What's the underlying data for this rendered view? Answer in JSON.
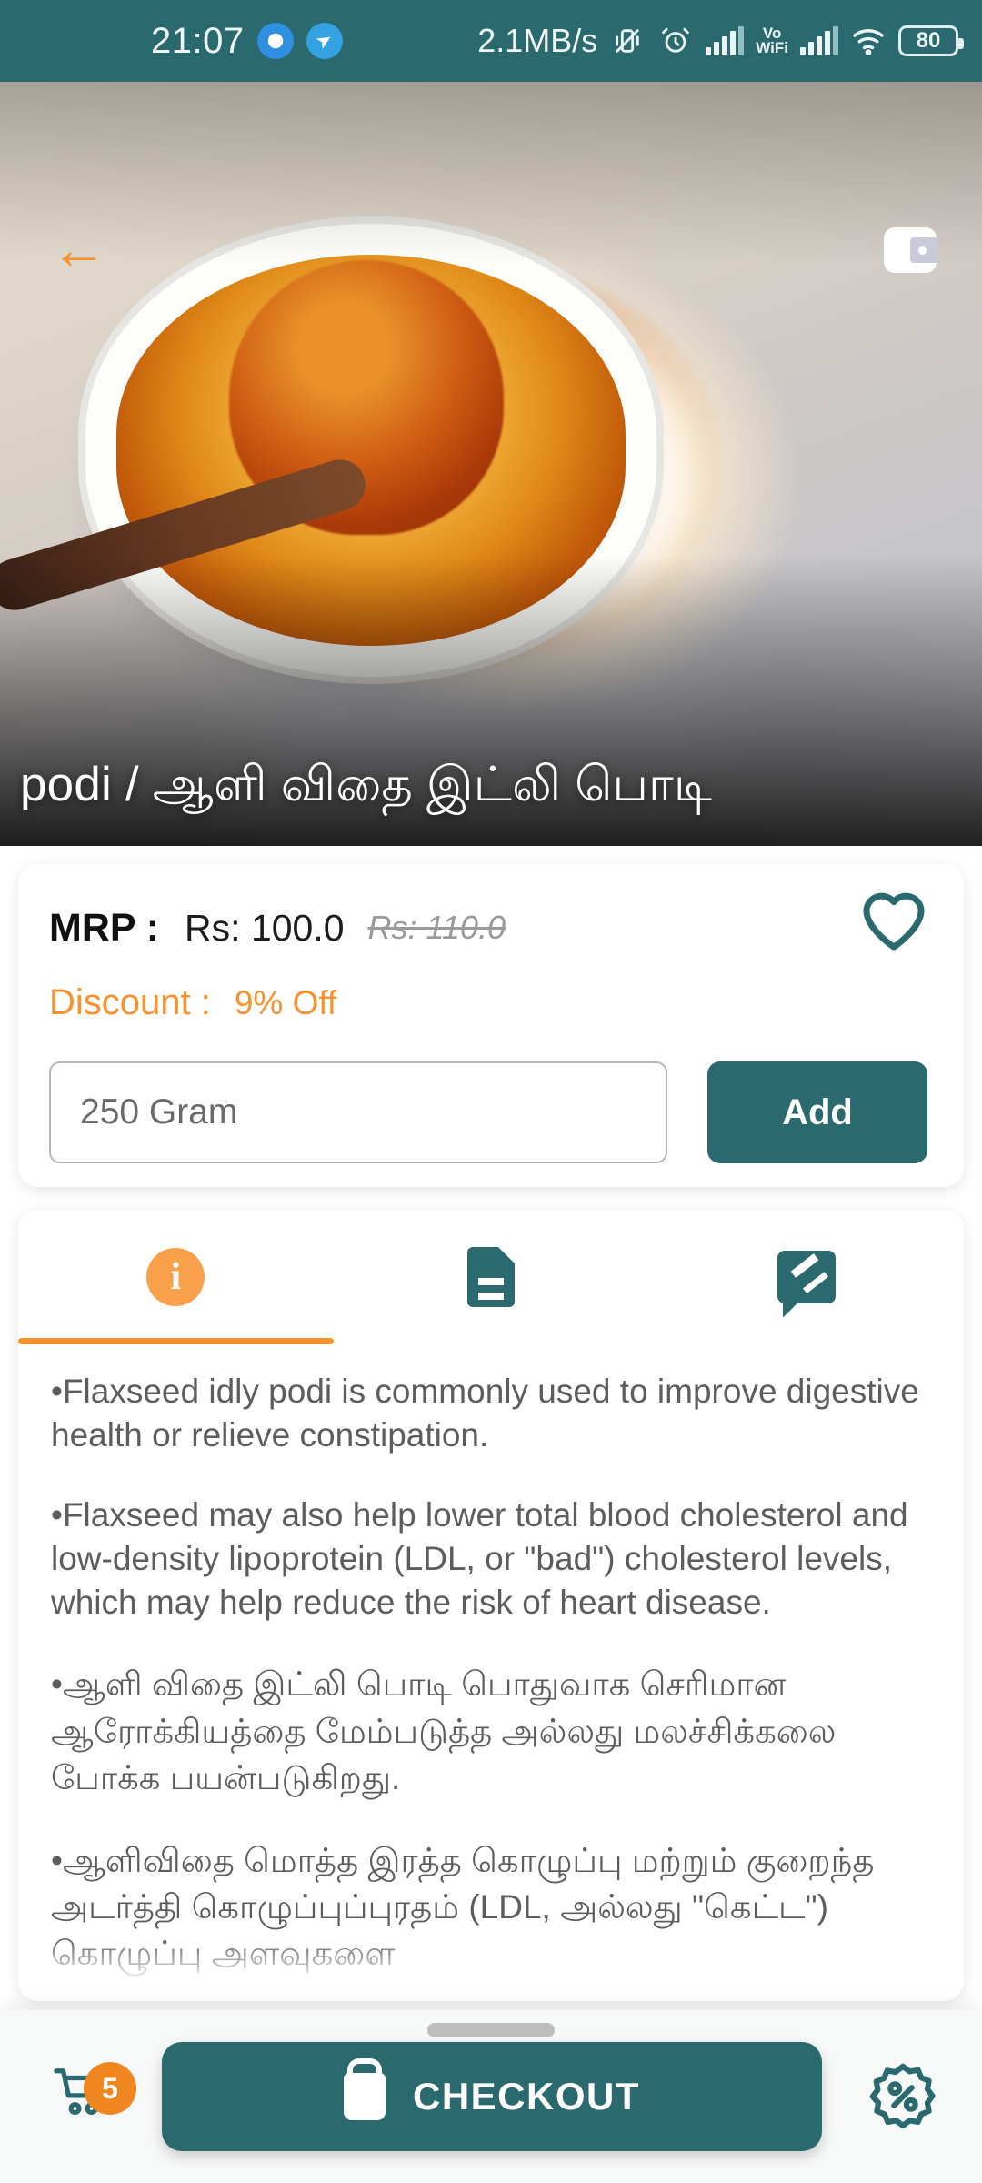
{
  "status_bar": {
    "time": "21:07",
    "network_speed": "2.1MB/s",
    "volte_label": "Vo\nWiFi",
    "battery_percent": "80",
    "icons": [
      "focus-dot-icon",
      "telegram-icon",
      "vibrate-off-icon",
      "alarm-icon",
      "signal-bars-icon",
      "volte-wifi-icon",
      "signal-bars-2-icon",
      "wifi-icon",
      "battery-icon"
    ],
    "bg_color": "#2a6a6e"
  },
  "hero": {
    "back_icon": "back-arrow-icon",
    "wallet_icon": "wallet-icon",
    "product_title": "podi / ஆளி விதை இட்லி பொடி"
  },
  "price_card": {
    "mrp_label": "MRP :",
    "mrp_value": "Rs: 100.0",
    "mrp_old_value": "Rs: 110.0",
    "discount_label": "Discount :",
    "discount_value": "9% Off",
    "favorite_icon": "heart-outline-icon",
    "quantity_value": "250 Gram",
    "add_label": "Add"
  },
  "tabs": [
    {
      "name": "information",
      "icon": "info-circle-icon",
      "active": true
    },
    {
      "name": "details",
      "icon": "document-icon",
      "active": false
    },
    {
      "name": "reviews",
      "icon": "review-comment-icon",
      "active": false
    }
  ],
  "description": {
    "paragraphs": [
      "•Flaxseed idly podi is commonly used to improve digestive health or relieve constipation.",
      "•Flaxseed may also help lower total blood cholesterol and low-density lipoprotein (LDL, or \"bad\") cholesterol levels, which may help reduce the risk of heart disease.",
      "•ஆளி விதை இட்லி பொடி பொதுவாக செரிமான ஆரோக்கியத்தை மேம்படுத்த அல்லது மலச்சிக்கலை போக்க பயன்படுகிறது.",
      "•ஆளிவிதை மொத்த இரத்த கொழுப்பு மற்றும் குறைந்த அடர்த்தி கொழுப்புப்புரதம் (LDL, அல்லது \"கெட்ட\") கொழுப்பு அளவுகளை"
    ]
  },
  "bottom_bar": {
    "cart_icon": "shopping-cart-icon",
    "cart_badge_count": "5",
    "checkout_label": "CHECKOUT",
    "checkout_bag_icon": "shopping-bag-icon",
    "offer_icon": "discount-percent-badge-icon"
  },
  "colors": {
    "teal": "#2a6a6e",
    "orange": "#f7922f",
    "badge_orange": "#f0861f",
    "muted_text": "#5d5d5d"
  }
}
